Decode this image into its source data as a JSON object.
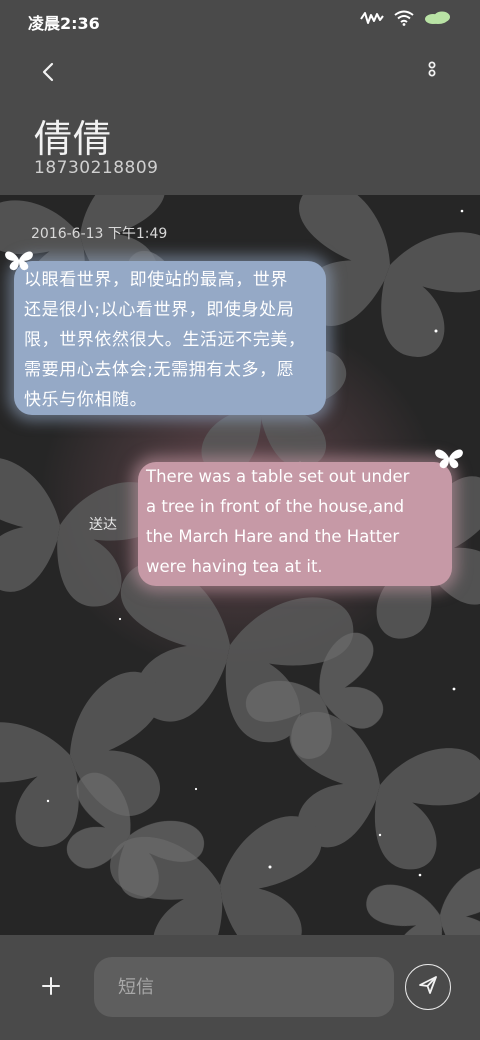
{
  "status_bar": {
    "time": "凌晨2:36",
    "icons": [
      "activity-icon",
      "wifi-icon",
      "battery-icon"
    ]
  },
  "header": {
    "back_icon": "chevron-left-icon",
    "more_icon": "more-vertical-icon",
    "contact_name": "倩倩",
    "contact_number": "18730218809"
  },
  "conversation": {
    "timestamp": "2016-6-13 下午1:49",
    "messages": [
      {
        "direction": "incoming",
        "lines": [
          "以眼看世界，即使站的最高，世界",
          "还是很小;以心看世界，即使身处局",
          "限，世界依然很大。生活远不完美，",
          "需要用心去体会;无需拥有太多，愿",
          "快乐与你相随。"
        ],
        "color": "#95a9c6"
      },
      {
        "direction": "outgoing",
        "lines": [
          "There was a table set out under",
          "a tree in front of the house,and",
          "the March Hare and the Hatter",
          "were having tea at it."
        ],
        "status": "送达",
        "color": "#c699a6"
      }
    ]
  },
  "compose": {
    "add_icon": "plus-icon",
    "placeholder": "短信",
    "value": "",
    "send_icon": "send-icon"
  },
  "colors": {
    "header_bg": "#4a4a4a",
    "chat_bg": "#2b2b2b",
    "incoming_bubble": "#95a9c6",
    "outgoing_bubble": "#c699a6"
  }
}
